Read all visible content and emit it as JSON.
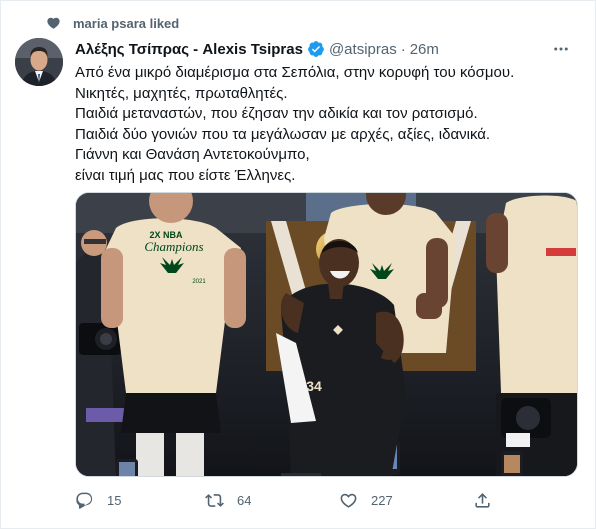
{
  "context": {
    "liked_by": "maria psara liked"
  },
  "tweet": {
    "author_name": "Αλέξης Τσίπρας - Alexis Tsipras",
    "handle": "@atsipras",
    "separator": "·",
    "time": "26m",
    "lines": [
      "Από ένα μικρό διαμέρισμα στα Σεπόλια, στην κορυφή του κόσμου.",
      "Νικητές, μαχητές, πρωταθλητές.",
      "Παιδιά μεταναστών, που έζησαν την αδικία και τον ρατσισμό.",
      "Παιδιά δύο γονιών που τα μεγάλωσαν με αρχές, αξίες, ιδανικά.",
      "Γιάννη και Θανάση Αντετοκούνμπο,",
      "είναι τιμή μας που είστε Έλληνες."
    ],
    "media": {
      "shirt_text_1": "2X NBA",
      "shirt_text_2": "Champions",
      "shirt_text_3": "2021",
      "jersey_number": "34"
    }
  },
  "actions": {
    "reply_count": "15",
    "retweet_count": "64",
    "like_count": "227"
  },
  "colors": {
    "text_primary": "#0f1419",
    "text_secondary": "#536471",
    "verified_blue": "#1d9bf0",
    "bucks_green": "#00471b",
    "bucks_cream": "#eee1c6"
  }
}
